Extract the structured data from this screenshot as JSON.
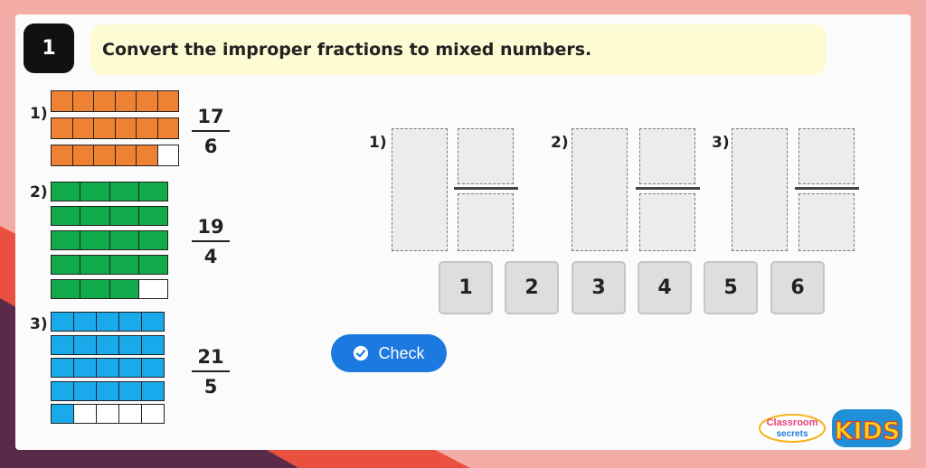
{
  "question": {
    "number": "1",
    "instruction": "Convert the improper fractions to mixed numbers."
  },
  "models": [
    {
      "label": "1)",
      "numerator": "17",
      "denominator": "6",
      "color": "#ef8132",
      "per_row": 6,
      "filled": 17
    },
    {
      "label": "2)",
      "numerator": "19",
      "denominator": "4",
      "color": "#10aa4a",
      "per_row": 4,
      "filled": 19
    },
    {
      "label": "3)",
      "numerator": "21",
      "denominator": "5",
      "color": "#19aaeb",
      "per_row": 5,
      "filled": 21
    }
  ],
  "answers": [
    {
      "label": "1)"
    },
    {
      "label": "2)"
    },
    {
      "label": "3)"
    }
  ],
  "tiles": [
    "1",
    "2",
    "3",
    "4",
    "5",
    "6"
  ],
  "check_label": "Check",
  "brand": {
    "classroom": "Classroom",
    "secrets": "secrets",
    "kids": "KIDS"
  }
}
